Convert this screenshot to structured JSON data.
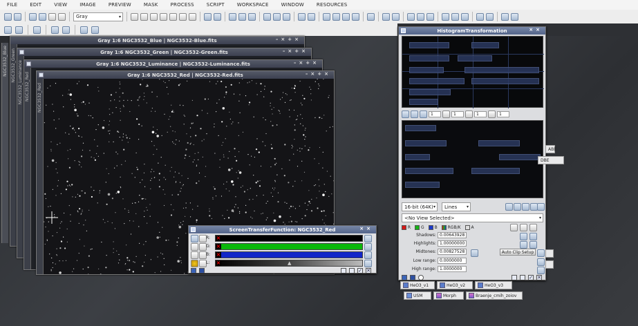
{
  "menu": [
    "FILE",
    "EDIT",
    "VIEW",
    "IMAGE",
    "PREVIEW",
    "MASK",
    "PROCESS",
    "SCRIPT",
    "WORKSPACE",
    "WINDOW",
    "RESOURCES"
  ],
  "toolbar": {
    "color_mode": "Gray"
  },
  "image_windows": [
    {
      "title": "Gray 1:6 NGC3532_Blue | NGC3532-Blue.fits",
      "tab": "NGC3532_Blue"
    },
    {
      "title": "Gray 1:6 NGC3532_Green | NGC3532-Green.fits",
      "tab": "NGC3532_Green"
    },
    {
      "title": "Gray 1:6 NGC3532_Luminance | NGC3532-Luminance.fits",
      "tab": "NGC3532_Luminance"
    },
    {
      "title": "Gray 1:6 NGC3532_Red | NGC3532-Red.fits",
      "tab": "NGC3532_Red"
    }
  ],
  "histogram": {
    "title": "HistogramTransformation",
    "spin_values": [
      "1",
      "1",
      "1",
      "1"
    ],
    "bit_depth": "16-bit (64K)",
    "scale": "Lines",
    "view_selected": "<No View Selected>",
    "channels": [
      "R",
      "G",
      "B",
      "RGB/K",
      "A"
    ],
    "shadows_label": "Shadows:",
    "shadows_value": "0.00643928",
    "highlights_label": "Highlights:",
    "highlights_value": "1.00000000",
    "midtones_label": "Midtones:",
    "midtones_value": "0.00827528",
    "auto_clip_label": "Auto Clip Setup",
    "low_range_label": "Low range:",
    "low_range_value": "0.0000000",
    "high_range_label": "High range:",
    "high_range_value": "1.0000000"
  },
  "stf": {
    "title": "ScreenTransferFunction: NGC3532_Red",
    "rows": [
      "R:",
      "G:",
      "B:",
      "L:"
    ],
    "row_colors": [
      "#000000",
      "#0bb70b",
      "#1226c8",
      "#4a4a4a"
    ]
  },
  "process_icons": [
    "HeO3_v1",
    "HeO3_v2",
    "HeO3_v3",
    "USM",
    "Morph",
    "Braenje_cmih_zoiov"
  ],
  "ghost_icons": [
    "ABE",
    "DBE"
  ]
}
